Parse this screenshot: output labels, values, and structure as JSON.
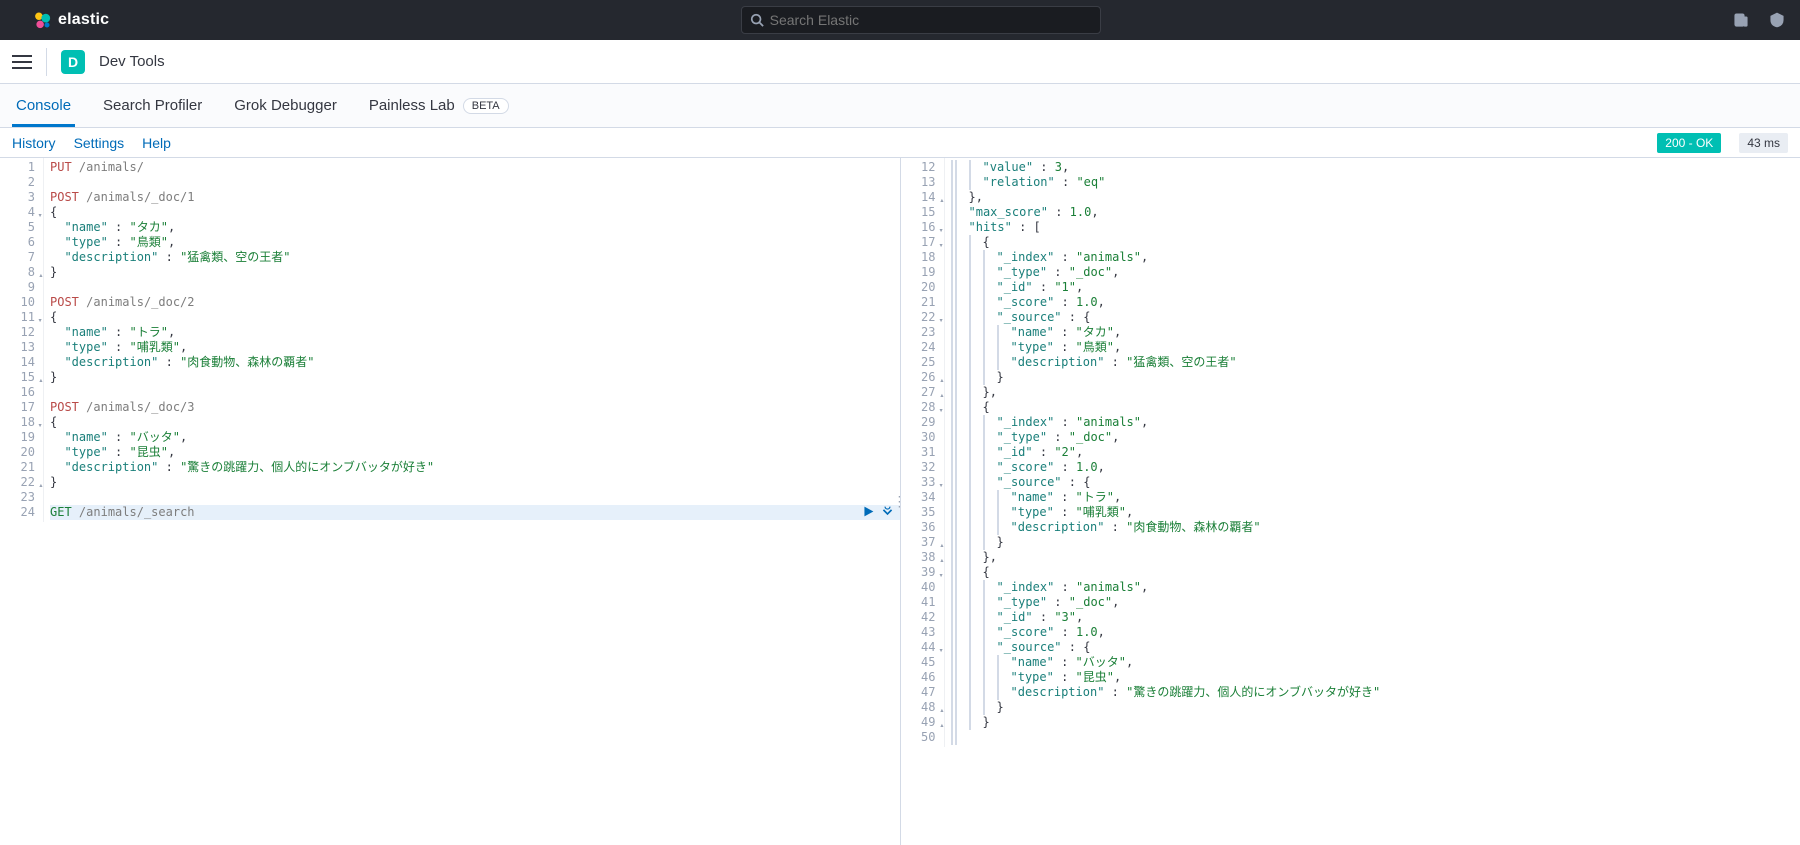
{
  "brand": "elastic",
  "search": {
    "placeholder": "Search Elastic"
  },
  "breadcrumb": {
    "badge": "D",
    "label": "Dev Tools"
  },
  "tabs": [
    {
      "label": "Console",
      "active": true
    },
    {
      "label": "Search Profiler"
    },
    {
      "label": "Grok Debugger"
    },
    {
      "label": "Painless Lab",
      "beta": "BETA"
    }
  ],
  "toolbar": {
    "history": "History",
    "settings": "Settings",
    "help": "Help"
  },
  "status": {
    "ok": "200 - OK",
    "time": "43 ms"
  },
  "editor": {
    "lines": [
      {
        "n": 1,
        "tokens": [
          [
            "PUT",
            "method-put"
          ],
          [
            " ",
            "ws"
          ],
          [
            "/animals/",
            "path"
          ]
        ]
      },
      {
        "n": 2,
        "tokens": []
      },
      {
        "n": 3,
        "tokens": [
          [
            "POST",
            "method-post"
          ],
          [
            " ",
            "ws"
          ],
          [
            "/animals/_doc/1",
            "path"
          ]
        ]
      },
      {
        "n": 4,
        "fold": "down",
        "tokens": [
          [
            "{",
            "brace"
          ]
        ]
      },
      {
        "n": 5,
        "tokens": [
          [
            "  ",
            "ws"
          ],
          [
            "\"name\"",
            "key"
          ],
          [
            " : ",
            "colon"
          ],
          [
            "\"タカ\"",
            "str"
          ],
          [
            ",",
            "punc"
          ]
        ]
      },
      {
        "n": 6,
        "tokens": [
          [
            "  ",
            "ws"
          ],
          [
            "\"type\"",
            "key"
          ],
          [
            " : ",
            "colon"
          ],
          [
            "\"鳥類\"",
            "str"
          ],
          [
            ",",
            "punc"
          ]
        ]
      },
      {
        "n": 7,
        "tokens": [
          [
            "  ",
            "ws"
          ],
          [
            "\"description\"",
            "key"
          ],
          [
            " : ",
            "colon"
          ],
          [
            "\"猛禽類、空の王者\"",
            "str"
          ]
        ]
      },
      {
        "n": 8,
        "fold": "up",
        "tokens": [
          [
            "}",
            "brace"
          ]
        ]
      },
      {
        "n": 9,
        "tokens": []
      },
      {
        "n": 10,
        "tokens": [
          [
            "POST",
            "method-post"
          ],
          [
            " ",
            "ws"
          ],
          [
            "/animals/_doc/2",
            "path"
          ]
        ]
      },
      {
        "n": 11,
        "fold": "down",
        "tokens": [
          [
            "{",
            "brace"
          ]
        ]
      },
      {
        "n": 12,
        "tokens": [
          [
            "  ",
            "ws"
          ],
          [
            "\"name\"",
            "key"
          ],
          [
            " : ",
            "colon"
          ],
          [
            "\"トラ\"",
            "str"
          ],
          [
            ",",
            "punc"
          ]
        ]
      },
      {
        "n": 13,
        "tokens": [
          [
            "  ",
            "ws"
          ],
          [
            "\"type\"",
            "key"
          ],
          [
            " : ",
            "colon"
          ],
          [
            "\"哺乳類\"",
            "str"
          ],
          [
            ",",
            "punc"
          ]
        ]
      },
      {
        "n": 14,
        "tokens": [
          [
            "  ",
            "ws"
          ],
          [
            "\"description\"",
            "key"
          ],
          [
            " : ",
            "colon"
          ],
          [
            "\"肉食動物、森林の覇者\"",
            "str"
          ]
        ]
      },
      {
        "n": 15,
        "fold": "up",
        "tokens": [
          [
            "}",
            "brace"
          ]
        ]
      },
      {
        "n": 16,
        "tokens": []
      },
      {
        "n": 17,
        "tokens": [
          [
            "POST",
            "method-post"
          ],
          [
            " ",
            "ws"
          ],
          [
            "/animals/_doc/3",
            "path"
          ]
        ]
      },
      {
        "n": 18,
        "fold": "down",
        "tokens": [
          [
            "{",
            "brace"
          ]
        ]
      },
      {
        "n": 19,
        "tokens": [
          [
            "  ",
            "ws"
          ],
          [
            "\"name\"",
            "key"
          ],
          [
            " : ",
            "colon"
          ],
          [
            "\"バッタ\"",
            "str"
          ],
          [
            ",",
            "punc"
          ]
        ]
      },
      {
        "n": 20,
        "tokens": [
          [
            "  ",
            "ws"
          ],
          [
            "\"type\"",
            "key"
          ],
          [
            " : ",
            "colon"
          ],
          [
            "\"昆虫\"",
            "str"
          ],
          [
            ",",
            "punc"
          ]
        ]
      },
      {
        "n": 21,
        "tokens": [
          [
            "  ",
            "ws"
          ],
          [
            "\"description\"",
            "key"
          ],
          [
            " : ",
            "colon"
          ],
          [
            "\"驚きの跳躍力、個人的にオンブバッタが好き\"",
            "str"
          ]
        ]
      },
      {
        "n": 22,
        "fold": "up",
        "tokens": [
          [
            "}",
            "brace"
          ]
        ]
      },
      {
        "n": 23,
        "tokens": []
      },
      {
        "n": 24,
        "hl": true,
        "run": true,
        "tokens": [
          [
            "GET",
            "method-get"
          ],
          [
            " ",
            "ws"
          ],
          [
            "/animals/_search",
            "path"
          ]
        ]
      }
    ]
  },
  "response": {
    "lines": [
      {
        "n": 12,
        "indent": 3,
        "tokens": [
          [
            "\"value\"",
            "key"
          ],
          [
            " : ",
            "colon"
          ],
          [
            "3",
            "num"
          ],
          [
            ",",
            "punc"
          ]
        ]
      },
      {
        "n": 13,
        "indent": 3,
        "tokens": [
          [
            "\"relation\"",
            "key"
          ],
          [
            " : ",
            "colon"
          ],
          [
            "\"eq\"",
            "str"
          ]
        ]
      },
      {
        "n": 14,
        "indent": 2,
        "fold": "up",
        "tokens": [
          [
            "},",
            "brace"
          ]
        ]
      },
      {
        "n": 15,
        "indent": 2,
        "tokens": [
          [
            "\"max_score\"",
            "key"
          ],
          [
            " : ",
            "colon"
          ],
          [
            "1.0",
            "num"
          ],
          [
            ",",
            "punc"
          ]
        ]
      },
      {
        "n": 16,
        "indent": 2,
        "fold": "down",
        "tokens": [
          [
            "\"hits\"",
            "key"
          ],
          [
            " : ",
            "colon"
          ],
          [
            "[",
            "brace"
          ]
        ]
      },
      {
        "n": 17,
        "indent": 3,
        "fold": "down",
        "tokens": [
          [
            "{",
            "brace"
          ]
        ]
      },
      {
        "n": 18,
        "indent": 4,
        "tokens": [
          [
            "\"_index\"",
            "key"
          ],
          [
            " : ",
            "colon"
          ],
          [
            "\"animals\"",
            "str"
          ],
          [
            ",",
            "punc"
          ]
        ]
      },
      {
        "n": 19,
        "indent": 4,
        "tokens": [
          [
            "\"_type\"",
            "key"
          ],
          [
            " : ",
            "colon"
          ],
          [
            "\"_doc\"",
            "str"
          ],
          [
            ",",
            "punc"
          ]
        ]
      },
      {
        "n": 20,
        "indent": 4,
        "tokens": [
          [
            "\"_id\"",
            "key"
          ],
          [
            " : ",
            "colon"
          ],
          [
            "\"1\"",
            "str"
          ],
          [
            ",",
            "punc"
          ]
        ]
      },
      {
        "n": 21,
        "indent": 4,
        "tokens": [
          [
            "\"_score\"",
            "key"
          ],
          [
            " : ",
            "colon"
          ],
          [
            "1.0",
            "num"
          ],
          [
            ",",
            "punc"
          ]
        ]
      },
      {
        "n": 22,
        "indent": 4,
        "fold": "down",
        "tokens": [
          [
            "\"_source\"",
            "key"
          ],
          [
            " : ",
            "colon"
          ],
          [
            "{",
            "brace"
          ]
        ]
      },
      {
        "n": 23,
        "indent": 5,
        "tokens": [
          [
            "\"name\"",
            "key"
          ],
          [
            " : ",
            "colon"
          ],
          [
            "\"タカ\"",
            "str"
          ],
          [
            ",",
            "punc"
          ]
        ]
      },
      {
        "n": 24,
        "indent": 5,
        "tokens": [
          [
            "\"type\"",
            "key"
          ],
          [
            " : ",
            "colon"
          ],
          [
            "\"鳥類\"",
            "str"
          ],
          [
            ",",
            "punc"
          ]
        ]
      },
      {
        "n": 25,
        "indent": 5,
        "tokens": [
          [
            "\"description\"",
            "key"
          ],
          [
            " : ",
            "colon"
          ],
          [
            "\"猛禽類、空の王者\"",
            "str"
          ]
        ]
      },
      {
        "n": 26,
        "indent": 4,
        "fold": "up",
        "tokens": [
          [
            "}",
            "brace"
          ]
        ]
      },
      {
        "n": 27,
        "indent": 3,
        "fold": "up",
        "tokens": [
          [
            "},",
            "brace"
          ]
        ]
      },
      {
        "n": 28,
        "indent": 3,
        "fold": "down",
        "tokens": [
          [
            "{",
            "brace"
          ]
        ]
      },
      {
        "n": 29,
        "indent": 4,
        "tokens": [
          [
            "\"_index\"",
            "key"
          ],
          [
            " : ",
            "colon"
          ],
          [
            "\"animals\"",
            "str"
          ],
          [
            ",",
            "punc"
          ]
        ]
      },
      {
        "n": 30,
        "indent": 4,
        "tokens": [
          [
            "\"_type\"",
            "key"
          ],
          [
            " : ",
            "colon"
          ],
          [
            "\"_doc\"",
            "str"
          ],
          [
            ",",
            "punc"
          ]
        ]
      },
      {
        "n": 31,
        "indent": 4,
        "tokens": [
          [
            "\"_id\"",
            "key"
          ],
          [
            " : ",
            "colon"
          ],
          [
            "\"2\"",
            "str"
          ],
          [
            ",",
            "punc"
          ]
        ]
      },
      {
        "n": 32,
        "indent": 4,
        "tokens": [
          [
            "\"_score\"",
            "key"
          ],
          [
            " : ",
            "colon"
          ],
          [
            "1.0",
            "num"
          ],
          [
            ",",
            "punc"
          ]
        ]
      },
      {
        "n": 33,
        "indent": 4,
        "fold": "down",
        "tokens": [
          [
            "\"_source\"",
            "key"
          ],
          [
            " : ",
            "colon"
          ],
          [
            "{",
            "brace"
          ]
        ]
      },
      {
        "n": 34,
        "indent": 5,
        "tokens": [
          [
            "\"name\"",
            "key"
          ],
          [
            " : ",
            "colon"
          ],
          [
            "\"トラ\"",
            "str"
          ],
          [
            ",",
            "punc"
          ]
        ]
      },
      {
        "n": 35,
        "indent": 5,
        "tokens": [
          [
            "\"type\"",
            "key"
          ],
          [
            " : ",
            "colon"
          ],
          [
            "\"哺乳類\"",
            "str"
          ],
          [
            ",",
            "punc"
          ]
        ]
      },
      {
        "n": 36,
        "indent": 5,
        "tokens": [
          [
            "\"description\"",
            "key"
          ],
          [
            " : ",
            "colon"
          ],
          [
            "\"肉食動物、森林の覇者\"",
            "str"
          ]
        ]
      },
      {
        "n": 37,
        "indent": 4,
        "fold": "up",
        "tokens": [
          [
            "}",
            "brace"
          ]
        ]
      },
      {
        "n": 38,
        "indent": 3,
        "fold": "up",
        "tokens": [
          [
            "},",
            "brace"
          ]
        ]
      },
      {
        "n": 39,
        "indent": 3,
        "fold": "down",
        "tokens": [
          [
            "{",
            "brace"
          ]
        ]
      },
      {
        "n": 40,
        "indent": 4,
        "tokens": [
          [
            "\"_index\"",
            "key"
          ],
          [
            " : ",
            "colon"
          ],
          [
            "\"animals\"",
            "str"
          ],
          [
            ",",
            "punc"
          ]
        ]
      },
      {
        "n": 41,
        "indent": 4,
        "tokens": [
          [
            "\"_type\"",
            "key"
          ],
          [
            " : ",
            "colon"
          ],
          [
            "\"_doc\"",
            "str"
          ],
          [
            ",",
            "punc"
          ]
        ]
      },
      {
        "n": 42,
        "indent": 4,
        "tokens": [
          [
            "\"_id\"",
            "key"
          ],
          [
            " : ",
            "colon"
          ],
          [
            "\"3\"",
            "str"
          ],
          [
            ",",
            "punc"
          ]
        ]
      },
      {
        "n": 43,
        "indent": 4,
        "tokens": [
          [
            "\"_score\"",
            "key"
          ],
          [
            " : ",
            "colon"
          ],
          [
            "1.0",
            "num"
          ],
          [
            ",",
            "punc"
          ]
        ]
      },
      {
        "n": 44,
        "indent": 4,
        "fold": "down",
        "tokens": [
          [
            "\"_source\"",
            "key"
          ],
          [
            " : ",
            "colon"
          ],
          [
            "{",
            "brace"
          ]
        ]
      },
      {
        "n": 45,
        "indent": 5,
        "tokens": [
          [
            "\"name\"",
            "key"
          ],
          [
            " : ",
            "colon"
          ],
          [
            "\"バッタ\"",
            "str"
          ],
          [
            ",",
            "punc"
          ]
        ]
      },
      {
        "n": 46,
        "indent": 5,
        "tokens": [
          [
            "\"type\"",
            "key"
          ],
          [
            " : ",
            "colon"
          ],
          [
            "\"昆虫\"",
            "str"
          ],
          [
            ",",
            "punc"
          ]
        ]
      },
      {
        "n": 47,
        "indent": 5,
        "tokens": [
          [
            "\"description\"",
            "key"
          ],
          [
            " : ",
            "colon"
          ],
          [
            "\"驚きの跳躍力、個人的にオンブバッタが好き\"",
            "str"
          ]
        ]
      },
      {
        "n": 48,
        "indent": 4,
        "fold": "up",
        "tokens": [
          [
            "}",
            "brace"
          ]
        ]
      },
      {
        "n": 49,
        "indent": 3,
        "fold": "up",
        "tokens": [
          [
            "}",
            "brace"
          ]
        ]
      },
      {
        "n": 50,
        "indent": 2,
        "tokens": []
      }
    ]
  }
}
